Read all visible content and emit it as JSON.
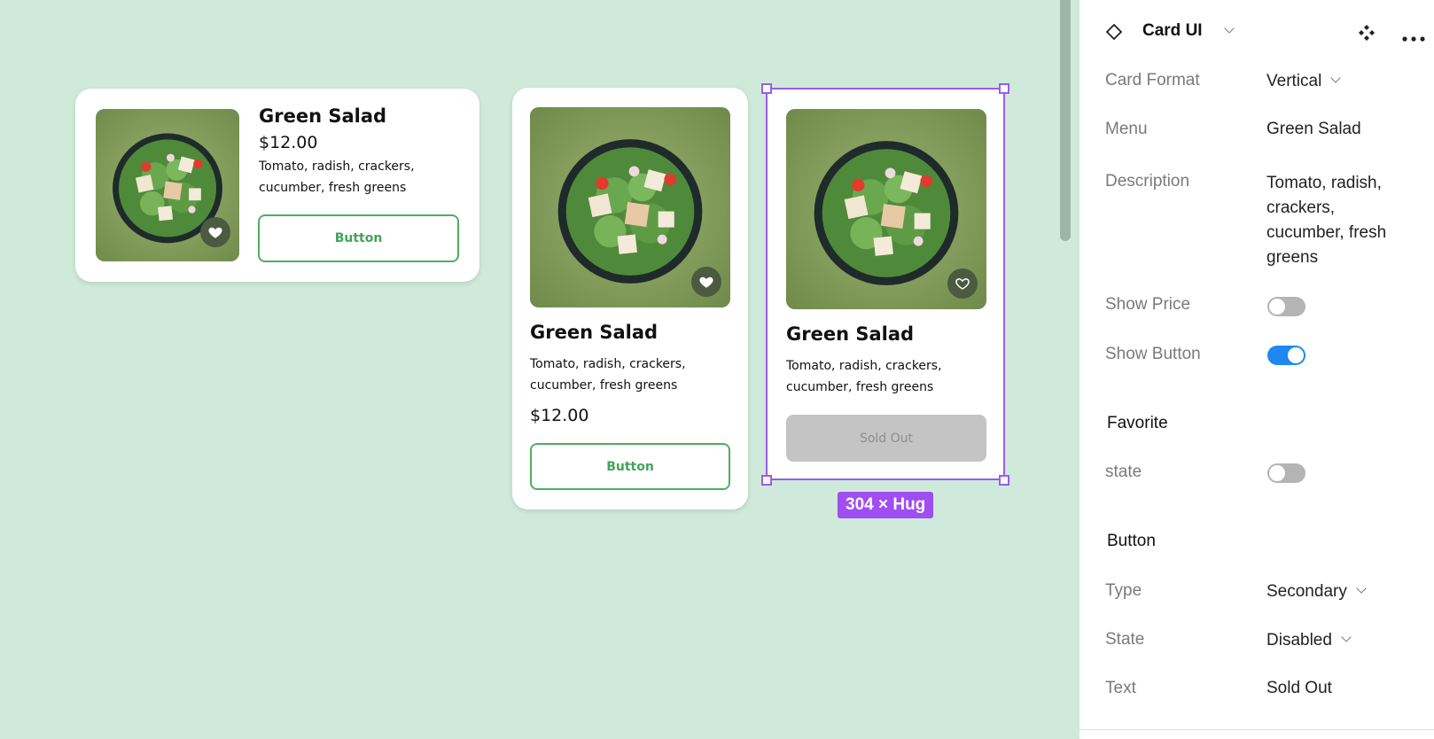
{
  "cards": [
    {
      "layout": "horizontal",
      "title": "Green Salad",
      "price": "$12.00",
      "description_lines": [
        "Tomato, radish, crackers,",
        "cucumber, fresh greens"
      ],
      "favorite": "filled",
      "button": "Button"
    },
    {
      "layout": "vertical",
      "title": "Green Salad",
      "description_lines": [
        "Tomato, radish, crackers,",
        "cucumber, fresh greens"
      ],
      "price": "$12.00",
      "favorite": "filled",
      "button": "Button"
    },
    {
      "layout": "vertical",
      "title": "Green Salad",
      "description_lines": [
        "Tomato, radish, crackers,",
        "cucumber, fresh greens"
      ],
      "favorite": "outline",
      "button": "Sold Out",
      "button_state": "disabled"
    }
  ],
  "selection": {
    "size_label": "304 × Hug"
  },
  "panel": {
    "component_name": "Card UI",
    "rows": {
      "card_format": {
        "label": "Card Format",
        "value": "Vertical"
      },
      "menu": {
        "label": "Menu",
        "value": "Green Salad"
      },
      "description": {
        "label": "Description",
        "value_lines": [
          "Tomato, radish,",
          "crackers,",
          "cucumber, fresh",
          "greens"
        ]
      },
      "show_price": {
        "label": "Show Price",
        "on": false
      },
      "show_button": {
        "label": "Show Button",
        "on": true
      }
    },
    "favorite_section": {
      "title": "Favorite",
      "state_label": "state",
      "state_on": false
    },
    "button_section": {
      "title": "Button",
      "type": {
        "label": "Type",
        "value": "Secondary"
      },
      "state": {
        "label": "State",
        "value": "Disabled"
      },
      "text": {
        "label": "Text",
        "value": "Sold Out"
      }
    }
  },
  "colors": {
    "canvas": "#cfeadb",
    "accent_green": "#4caf62",
    "selection": "#9b5cf0",
    "toggle_on": "#1e88f0"
  }
}
